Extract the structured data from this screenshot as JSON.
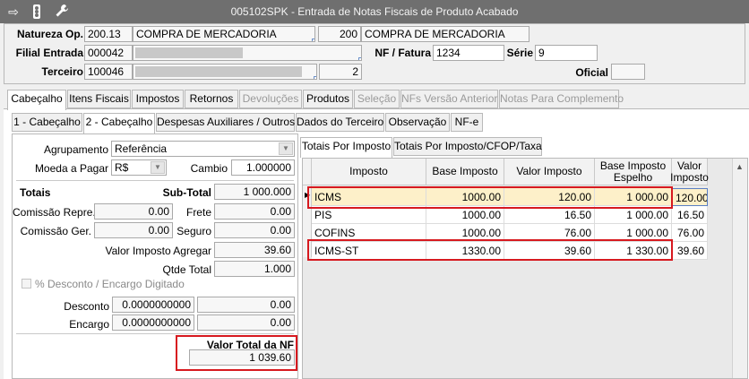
{
  "window": {
    "title": "005102SPK - Entrada de Notas Fiscais de Produto Acabado"
  },
  "toolbar_icons": [
    "export-icon",
    "traffic-light-icon",
    "wrench-icon"
  ],
  "header": {
    "natureza_label": "Natureza Op.",
    "natureza_code": "200.13",
    "natureza_desc": "COMPRA DE MERCADORIA",
    "natureza_code2": "200",
    "natureza_desc2": "COMPRA DE MERCADORIA",
    "filial_label": "Filial Entrada",
    "filial_code": "000042",
    "nf_label": "NF / Fatura",
    "nf_value": "1234",
    "serie_label": "Série",
    "serie_value": "9",
    "terceiro_label": "Terceiro",
    "terceiro_code": "100046",
    "terceiro_num": "2",
    "oficial_label": "Oficial",
    "oficial_value": ""
  },
  "main_tabs": [
    "Cabeçalho",
    "Itens Fiscais",
    "Impostos",
    "Retornos",
    "Devoluções",
    "Produtos",
    "Seleção",
    "NFs Versão Anterior",
    "Notas Para Complemento"
  ],
  "sub_tabs": [
    "1 - Cabeçalho",
    "2 - Cabeçalho",
    "Despesas Auxiliares / Outros",
    "Dados do Terceiro",
    "Observação",
    "NF-e"
  ],
  "left": {
    "agrupamento_label": "Agrupamento",
    "agrupamento_value": "Referência",
    "moeda_label": "Moeda a Pagar",
    "moeda_value": "R$",
    "cambio_label": "Cambio",
    "cambio_value": "1.000000",
    "totais_label": "Totais",
    "subtotal_label": "Sub-Total",
    "subtotal_value": "1 000.000",
    "comissao_repre_label": "Comissão Repre.",
    "comissao_repre_value": "0.00",
    "frete_label": "Frete",
    "frete_value": "0.00",
    "comissao_ger_label": "Comissão Ger.",
    "comissao_ger_value": "0.00",
    "seguro_label": "Seguro",
    "seguro_value": "0.00",
    "valor_imposto_agregar_label": "Valor Imposto Agregar",
    "valor_imposto_agregar_value": "39.60",
    "qtde_total_label": "Qtde Total",
    "qtde_total_value": "1.000",
    "desconto_check_label": "% Desconto / Encargo Digitado",
    "desconto_label": "Desconto",
    "desconto_pct": "0.0000000000",
    "desconto_value": "0.00",
    "encargo_label": "Encargo",
    "encargo_pct": "0.0000000000",
    "encargo_value": "0.00",
    "valor_total_label": "Valor Total da NF",
    "valor_total_value": "1 039.60"
  },
  "right_tabs": [
    "Totais Por Imposto",
    "Totais Por Imposto/CFOP/Taxa"
  ],
  "grid": {
    "columns": [
      "Imposto",
      "Base Imposto",
      "Valor Imposto",
      "Base Imposto Espelho",
      "Valor Imposto"
    ],
    "rows": [
      [
        "ICMS",
        "1000.00",
        "120.00",
        "1 000.00",
        "120.00"
      ],
      [
        "PIS",
        "1000.00",
        "16.50",
        "1 000.00",
        "16.50"
      ],
      [
        "COFINS",
        "1000.00",
        "76.00",
        "1 000.00",
        "76.00"
      ],
      [
        "ICMS-ST",
        "1330.00",
        "39.60",
        "1 330.00",
        "39.60"
      ]
    ]
  }
}
